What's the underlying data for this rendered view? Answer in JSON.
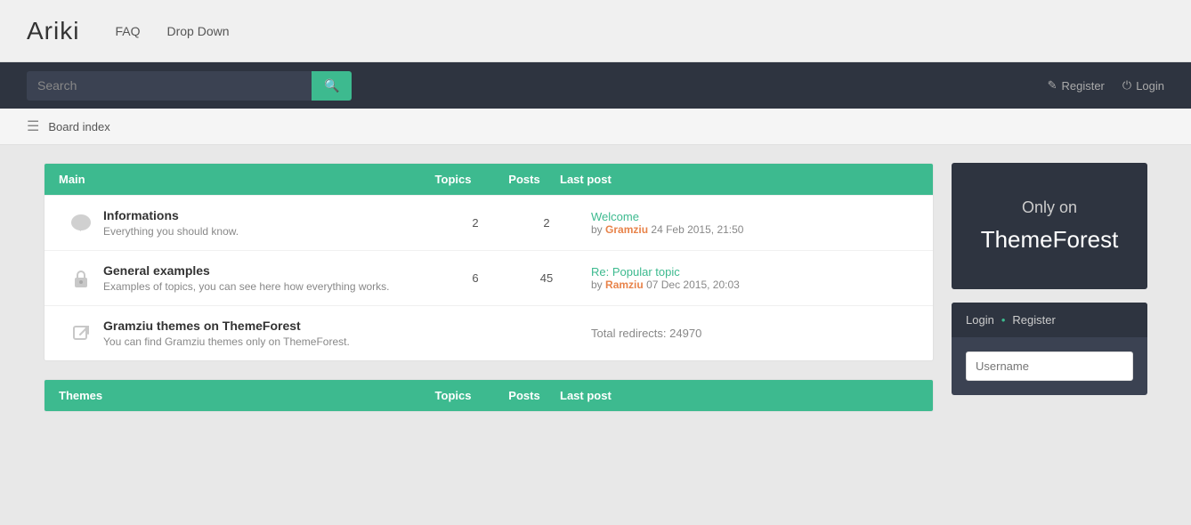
{
  "site": {
    "logo": "Ariki",
    "nav": [
      {
        "label": "FAQ",
        "id": "faq"
      },
      {
        "label": "Drop Down",
        "id": "dropdown"
      }
    ]
  },
  "searchBar": {
    "placeholder": "Search",
    "searchIconLabel": "🔍",
    "register_icon": "✎",
    "register_label": "Register",
    "login_icon": "⏻",
    "login_label": "Login"
  },
  "breadcrumb": {
    "board_index": "Board index"
  },
  "mainSection": {
    "header": {
      "title": "Main",
      "topics": "Topics",
      "posts": "Posts",
      "last_post": "Last post"
    },
    "rows": [
      {
        "icon": "bubble",
        "title": "Informations",
        "desc": "Everything you should know.",
        "topics": "2",
        "posts": "2",
        "last_title": "Welcome",
        "last_by": "by",
        "last_author": "Gramziu",
        "last_date": "24 Feb 2015, 21:50"
      },
      {
        "icon": "lock",
        "title": "General examples",
        "desc": "Examples of topics, you can see here how everything works.",
        "topics": "6",
        "posts": "45",
        "last_title": "Re: Popular topic",
        "last_by": "by",
        "last_author": "Ramziu",
        "last_date": "07 Dec 2015, 20:03"
      },
      {
        "icon": "external",
        "title": "Gramziu themes on ThemeForest",
        "desc": "You can find Gramziu themes only on ThemeForest.",
        "topics": "",
        "posts": "",
        "redirects": "Total redirects: 24970"
      }
    ]
  },
  "themesSection": {
    "header": {
      "title": "Themes",
      "topics": "Topics",
      "posts": "Posts",
      "last_post": "Last post"
    }
  },
  "sidebar": {
    "promo_line1": "Only on",
    "promo_line2": "ThemeForest",
    "login_label": "Login",
    "dot": "•",
    "register_label": "Register",
    "username_placeholder": "Username"
  }
}
